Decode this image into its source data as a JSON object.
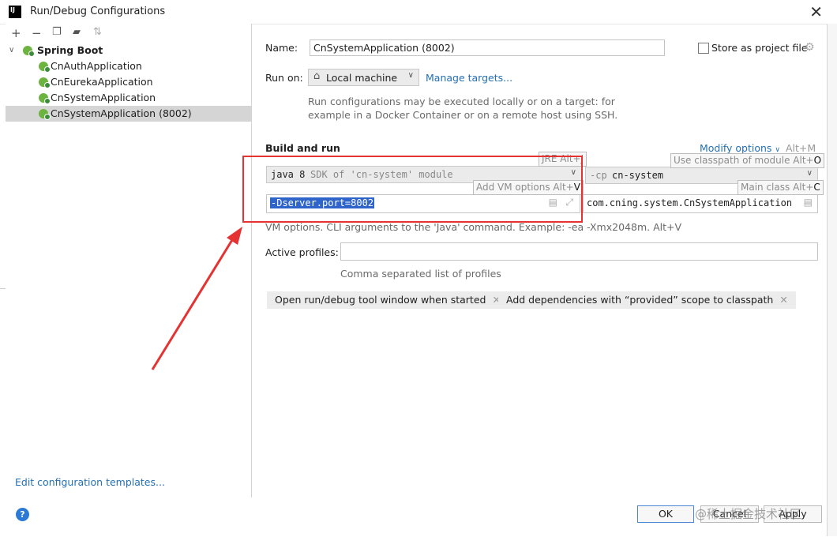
{
  "window": {
    "title": "Run/Debug Configurations",
    "icon_text": "IJ"
  },
  "toolbar": {
    "icons": [
      "plus-icon",
      "minus-icon",
      "copy-icon",
      "folder-icon",
      "sort-icon"
    ]
  },
  "tree": {
    "group": "Spring Boot",
    "items": [
      "CnAuthApplication",
      "CnEurekaApplication",
      "CnSystemApplication",
      "CnSystemApplication (8002)"
    ],
    "selected_index": 3
  },
  "left_footer": {
    "edit_templates": "Edit configuration templates..."
  },
  "form": {
    "name_label": "Name:",
    "name_value": "CnSystemApplication (8002)",
    "store_label": "Store as project file",
    "run_on_label": "Run on:",
    "run_on_value": "Local machine",
    "manage_targets": "Manage targets...",
    "run_on_hint_1": "Run configurations may be executed locally or on a target: for",
    "run_on_hint_2": "example in a Docker Container or on a remote host using SSH.",
    "build_run_title": "Build and run",
    "modify_options": "Modify options",
    "modify_shortcut": "Alt+M",
    "jre_value_bold": "java 8",
    "jre_value_hint": "SDK of 'cn-system' module",
    "cp_prefix": "-cp",
    "cp_value": "cn-system",
    "vm_options_value": "-Dserver.port=8002",
    "main_class_value": "com.cning.system.CnSystemApplication",
    "vm_hint": "VM options. CLI arguments to the 'Java' command. Example: -ea -Xmx2048m. Alt+V",
    "active_profiles_label": "Active profiles:",
    "active_profiles_value": "",
    "active_profiles_hint": "Comma separated list of profiles",
    "chips": [
      "Open run/debug tool window when started",
      "Add dependencies with “provided” scope to classpath"
    ]
  },
  "tooltips": {
    "jre": "JRE Alt+J",
    "jre_key": "",
    "classpath": "Use classpath of module Alt+",
    "classpath_key": "O",
    "vm": "Add VM options Alt+",
    "vm_key": "V",
    "main_class": "Main class Alt+",
    "main_class_key": "C"
  },
  "buttons": {
    "ok": "OK",
    "cancel": "Cancel",
    "apply": "Apply"
  },
  "watermark": "@稀土掘金技术社区",
  "colors": {
    "accent": "#2470b3",
    "selection": "#2f65ca",
    "annotation": "#e53232",
    "spring": "#6db33f"
  }
}
